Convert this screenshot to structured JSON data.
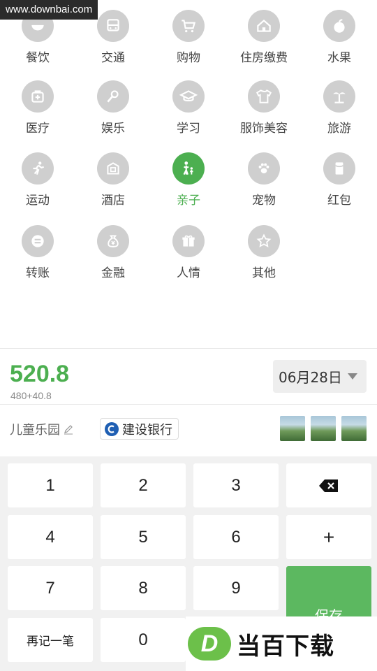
{
  "watermark": {
    "top_text": "www.downbai.com",
    "logo_letter": "D",
    "logo_text": "当百下载"
  },
  "categories": [
    {
      "label": "餐饮",
      "icon": "bowl-icon"
    },
    {
      "label": "交通",
      "icon": "bus-icon"
    },
    {
      "label": "购物",
      "icon": "cart-icon"
    },
    {
      "label": "住房缴费",
      "icon": "house-icon"
    },
    {
      "label": "水果",
      "icon": "fruit-icon"
    },
    {
      "label": "医疗",
      "icon": "medkit-icon"
    },
    {
      "label": "娱乐",
      "icon": "microphone-icon"
    },
    {
      "label": "学习",
      "icon": "graduation-cap-icon"
    },
    {
      "label": "服饰美容",
      "icon": "shirt-icon"
    },
    {
      "label": "旅游",
      "icon": "palm-tree-icon"
    },
    {
      "label": "运动",
      "icon": "runner-icon"
    },
    {
      "label": "酒店",
      "icon": "hotel-icon"
    },
    {
      "label": "亲子",
      "icon": "parent-child-icon"
    },
    {
      "label": "宠物",
      "icon": "paw-icon"
    },
    {
      "label": "红包",
      "icon": "red-envelope-icon"
    },
    {
      "label": "转账",
      "icon": "transfer-icon"
    },
    {
      "label": "金融",
      "icon": "money-bag-icon"
    },
    {
      "label": "人情",
      "icon": "gift-icon"
    },
    {
      "label": "其他",
      "icon": "star-icon"
    }
  ],
  "selected_category": "亲子",
  "accent_color": "#4caf50",
  "amount": {
    "value": "520.8",
    "formula": "480+40.8"
  },
  "date": {
    "label": "06月28日"
  },
  "note": {
    "text": "儿童乐园"
  },
  "account": {
    "bank_name": "建设银行"
  },
  "keypad": {
    "k1": "1",
    "k2": "2",
    "k3": "3",
    "k4": "4",
    "k5": "5",
    "k6": "6",
    "k7": "7",
    "k8": "8",
    "k9": "9",
    "k0": "0",
    "plus": "+",
    "again": "再记一笔",
    "save": "保存"
  }
}
